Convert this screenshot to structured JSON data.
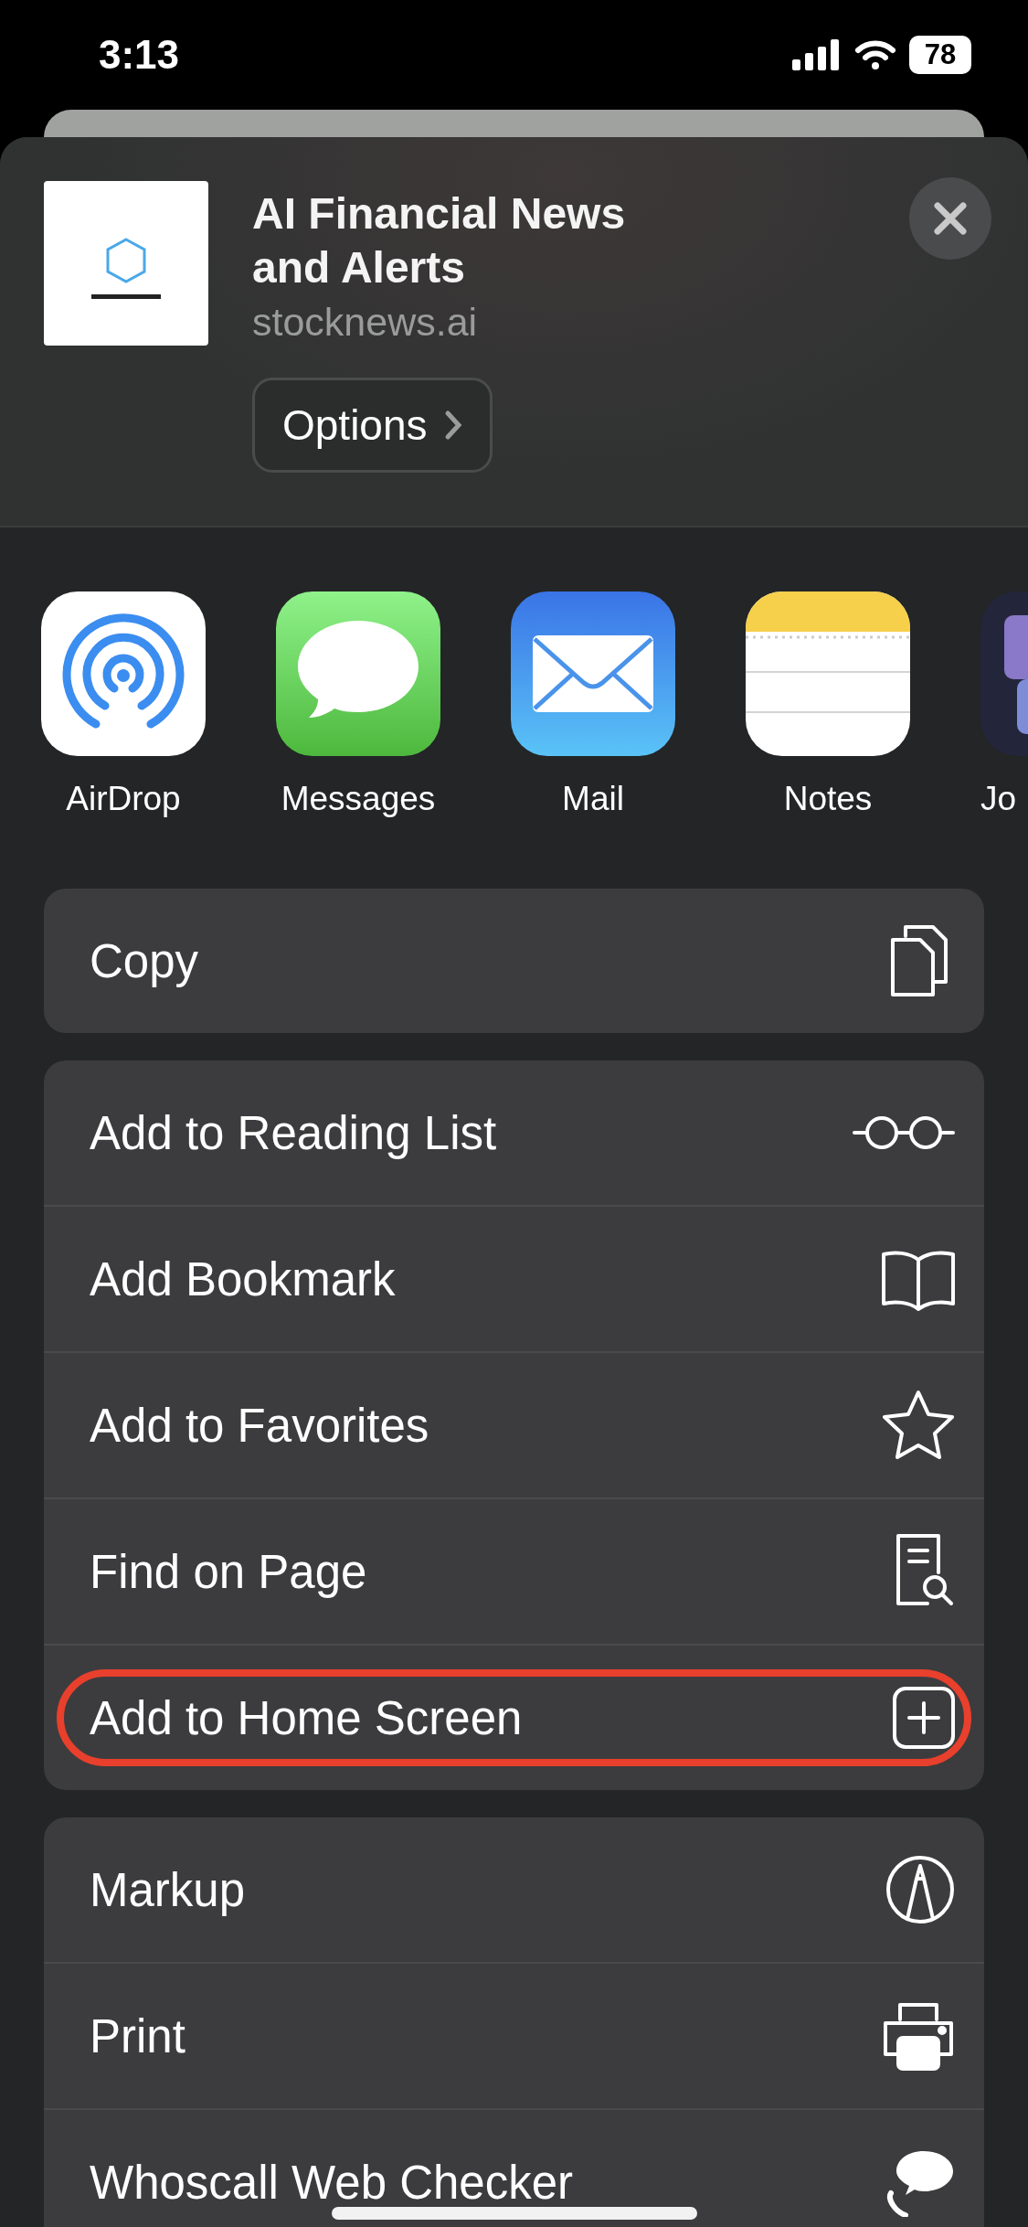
{
  "status_bar": {
    "time": "3:13",
    "battery": "78"
  },
  "share_header": {
    "title": "AI Financial News and Alerts",
    "url": "stocknews.ai",
    "options_button": "Options"
  },
  "apps": [
    {
      "kind": "airdrop",
      "label": "AirDrop"
    },
    {
      "kind": "messages",
      "label": "Messages"
    },
    {
      "kind": "mail",
      "label": "Mail"
    },
    {
      "kind": "notes",
      "label": "Notes"
    },
    {
      "kind": "partial",
      "label": "Jo"
    }
  ],
  "action_groups": [
    {
      "actions": [
        {
          "kind": "copy",
          "label": "Copy",
          "highlighted": false
        }
      ]
    },
    {
      "actions": [
        {
          "kind": "glasses",
          "label": "Add to Reading List",
          "highlighted": false
        },
        {
          "kind": "book",
          "label": "Add Bookmark",
          "highlighted": false
        },
        {
          "kind": "star",
          "label": "Add to Favorites",
          "highlighted": false
        },
        {
          "kind": "find",
          "label": "Find on Page",
          "highlighted": false
        },
        {
          "kind": "plus",
          "label": "Add to Home Screen",
          "highlighted": true
        }
      ]
    },
    {
      "actions": [
        {
          "kind": "markup",
          "label": "Markup",
          "highlighted": false
        },
        {
          "kind": "print",
          "label": "Print",
          "highlighted": false
        },
        {
          "kind": "whoscall",
          "label": "Whoscall Web Checker",
          "highlighted": false
        }
      ]
    }
  ]
}
